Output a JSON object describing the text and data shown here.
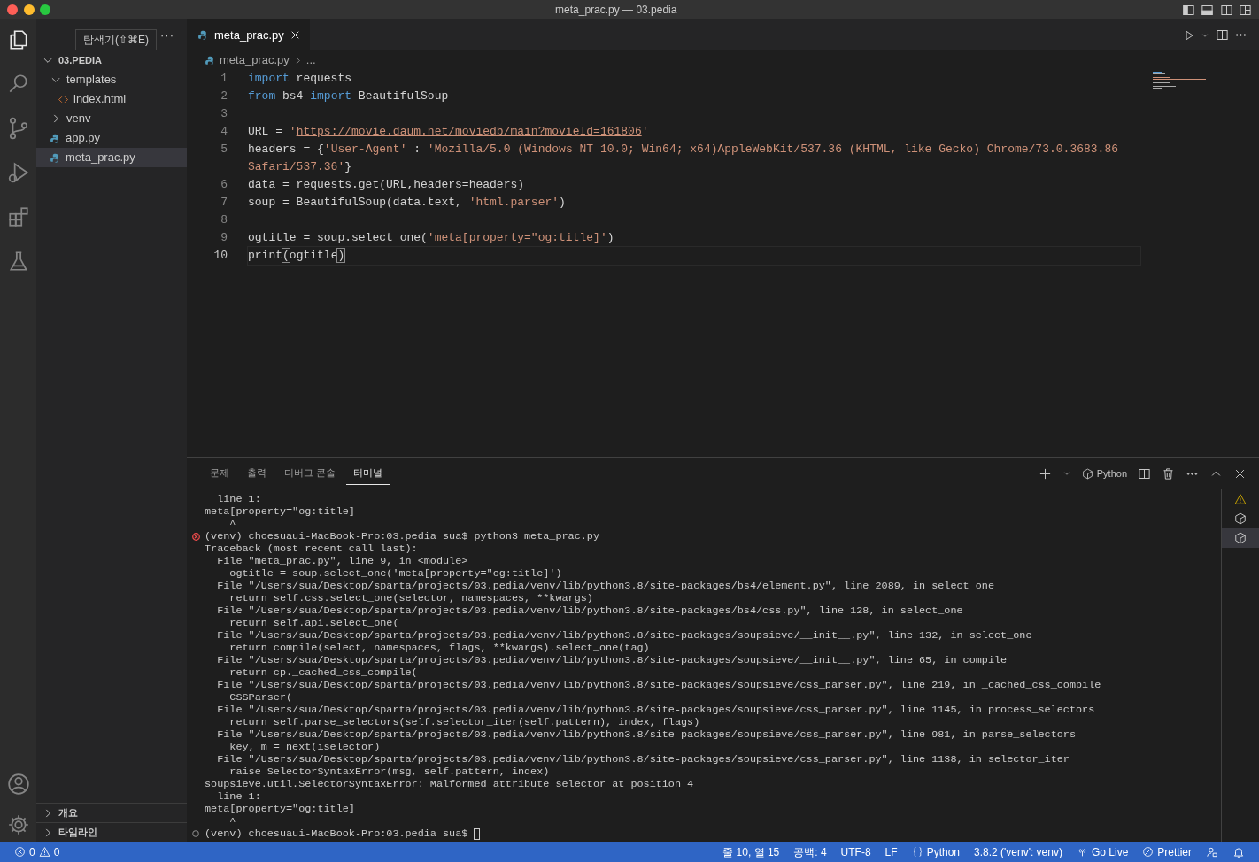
{
  "window": {
    "title": "meta_prac.py — 03.pedia"
  },
  "activity_bar": [
    {
      "kind": "files",
      "selected": true
    },
    {
      "kind": "search",
      "selected": false
    },
    {
      "kind": "source-control",
      "selected": false
    },
    {
      "kind": "run-debug",
      "selected": false
    },
    {
      "kind": "extensions",
      "selected": false
    },
    {
      "kind": "testing",
      "selected": false
    }
  ],
  "activity_bar_bottom": [
    {
      "kind": "account"
    },
    {
      "kind": "settings"
    }
  ],
  "tooltip": "탐색기(⇧⌘E)",
  "explorer": {
    "more": "···",
    "root": {
      "label": "03.PEDIA",
      "expanded": true,
      "children": [
        {
          "label": "templates",
          "expanded": true,
          "selected": false,
          "children": [
            {
              "label": "index.html",
              "kind": "html",
              "selected": false
            }
          ]
        },
        {
          "label": "venv",
          "expanded": false,
          "selected": false
        },
        {
          "label": "app.py",
          "kind": "python",
          "selected": false
        },
        {
          "label": "meta_prac.py",
          "kind": "python",
          "selected": true
        }
      ]
    },
    "sections": [
      {
        "label": "개요",
        "expanded": false
      },
      {
        "label": "타임라인",
        "expanded": false
      }
    ]
  },
  "tabs": [
    {
      "label": "meta_prac.py",
      "kind": "python",
      "selected": true
    }
  ],
  "breadcrumb": {
    "file": "meta_prac.py",
    "rest": "..."
  },
  "code": {
    "lines": [
      {
        "number": "1",
        "current": false,
        "tokens": [
          {
            "kind": "keyword",
            "text": "import"
          },
          {
            "kind": "text",
            "text": " requests"
          }
        ]
      },
      {
        "number": "2",
        "current": false,
        "tokens": [
          {
            "kind": "keyword",
            "text": "from"
          },
          {
            "kind": "text",
            "text": " bs4 "
          },
          {
            "kind": "keyword",
            "text": "import"
          },
          {
            "kind": "text",
            "text": " BeautifulSoup"
          }
        ]
      },
      {
        "number": "3",
        "current": false
      },
      {
        "number": "4",
        "current": false,
        "tokens": [
          {
            "kind": "text",
            "text": "URL = "
          },
          {
            "kind": "string",
            "text": "'"
          },
          {
            "kind": "link",
            "text": "https://movie.daum.net/moviedb/main?movieId=161806"
          },
          {
            "kind": "string",
            "text": "'"
          }
        ]
      },
      {
        "number": "5",
        "current": false,
        "tokens": [
          {
            "kind": "text",
            "text": "headers = {"
          },
          {
            "kind": "string",
            "text": "'User-Agent'"
          },
          {
            "kind": "text",
            "text": " : "
          },
          {
            "kind": "string",
            "text": "'Mozilla/5.0 (Windows NT 10.0; Win64; x64)AppleWebKit/537.36 (KHTML, like Gecko) Chrome/73.0.3683.86 Safari/537.36'"
          },
          {
            "kind": "text",
            "text": "}"
          }
        ]
      },
      {
        "number": "6",
        "current": false,
        "tokens": [
          {
            "kind": "text",
            "text": "data = requests.get(URL,headers=headers)"
          }
        ]
      },
      {
        "number": "7",
        "current": false,
        "tokens": [
          {
            "kind": "text",
            "text": "soup = BeautifulSoup(data.text, "
          },
          {
            "kind": "string",
            "text": "'html.parser'"
          },
          {
            "kind": "text",
            "text": ")"
          }
        ]
      },
      {
        "number": "8",
        "current": false
      },
      {
        "number": "9",
        "current": false,
        "tokens": [
          {
            "kind": "text",
            "text": "ogtitle = soup.select_one("
          },
          {
            "kind": "string",
            "text": "'meta[property=\"og:title]'"
          },
          {
            "kind": "text",
            "text": ")"
          }
        ]
      },
      {
        "number": "10",
        "current": true,
        "tokens": [
          {
            "kind": "text",
            "text": "print"
          },
          {
            "kind": "bracket",
            "text": "("
          },
          {
            "kind": "text",
            "text": "ogtitle"
          },
          {
            "kind": "bracket",
            "text": ")"
          }
        ]
      }
    ]
  },
  "panel": {
    "tabs": [
      {
        "label": "문제",
        "selected": false
      },
      {
        "label": "출력",
        "selected": false
      },
      {
        "label": "디버그 콘솔",
        "selected": false
      },
      {
        "label": "터미널",
        "selected": true
      }
    ],
    "toolbar": [
      {
        "kind": "plus"
      },
      {
        "kind": "caret"
      },
      {
        "kind": "terminal",
        "label": "Python"
      },
      {
        "kind": "split"
      },
      {
        "kind": "trash"
      },
      {
        "kind": "more"
      },
      {
        "kind": "maximize"
      },
      {
        "kind": "close"
      }
    ],
    "terminals": [
      {
        "kind": "warning",
        "selected": false
      },
      {
        "kind": "python",
        "selected": false
      },
      {
        "kind": "python",
        "selected": true
      }
    ],
    "lines": [
      {
        "text": "  line 1:"
      },
      {
        "text": "meta[property=\"og:title]"
      },
      {
        "text": "    ^"
      },
      {
        "text": "(venv) choesuaui-MacBook-Pro:03.pedia sua$ python3 meta_prac.py",
        "failed": true
      },
      {
        "text": "Traceback (most recent call last):"
      },
      {
        "text": "  File \"meta_prac.py\", line 9, in <module>"
      },
      {
        "text": "    ogtitle = soup.select_one('meta[property=\"og:title]')"
      },
      {
        "text": "  File \"/Users/sua/Desktop/sparta/projects/03.pedia/venv/lib/python3.8/site-packages/bs4/element.py\", line 2089, in select_one"
      },
      {
        "text": "    return self.css.select_one(selector, namespaces, **kwargs)"
      },
      {
        "text": "  File \"/Users/sua/Desktop/sparta/projects/03.pedia/venv/lib/python3.8/site-packages/bs4/css.py\", line 128, in select_one"
      },
      {
        "text": "    return self.api.select_one("
      },
      {
        "text": "  File \"/Users/sua/Desktop/sparta/projects/03.pedia/venv/lib/python3.8/site-packages/soupsieve/__init__.py\", line 132, in select_one"
      },
      {
        "text": "    return compile(select, namespaces, flags, **kwargs).select_one(tag)"
      },
      {
        "text": "  File \"/Users/sua/Desktop/sparta/projects/03.pedia/venv/lib/python3.8/site-packages/soupsieve/__init__.py\", line 65, in compile"
      },
      {
        "text": "    return cp._cached_css_compile("
      },
      {
        "text": "  File \"/Users/sua/Desktop/sparta/projects/03.pedia/venv/lib/python3.8/site-packages/soupsieve/css_parser.py\", line 219, in _cached_css_compile"
      },
      {
        "text": "    CSSParser("
      },
      {
        "text": "  File \"/Users/sua/Desktop/sparta/projects/03.pedia/venv/lib/python3.8/site-packages/soupsieve/css_parser.py\", line 1145, in process_selectors"
      },
      {
        "text": "    return self.parse_selectors(self.selector_iter(self.pattern), index, flags)"
      },
      {
        "text": "  File \"/Users/sua/Desktop/sparta/projects/03.pedia/venv/lib/python3.8/site-packages/soupsieve/css_parser.py\", line 981, in parse_selectors"
      },
      {
        "text": "    key, m = next(iselector)"
      },
      {
        "text": "  File \"/Users/sua/Desktop/sparta/projects/03.pedia/venv/lib/python3.8/site-packages/soupsieve/css_parser.py\", line 1138, in selector_iter"
      },
      {
        "text": "    raise SelectorSyntaxError(msg, self.pattern, index)"
      },
      {
        "text": "soupsieve.util.SelectorSyntaxError: Malformed attribute selector at position 4"
      },
      {
        "text": "  line 1:"
      },
      {
        "text": "meta[property=\"og:title]"
      },
      {
        "text": "    ^"
      },
      {
        "text": "(venv) choesuaui-MacBook-Pro:03.pedia sua$ ",
        "failed": false,
        "cursor": true
      }
    ]
  },
  "status_bar": {
    "errors": "0",
    "warnings": "0",
    "items": [
      {
        "text": "줄 10, 열 15"
      },
      {
        "text": "공백: 4"
      },
      {
        "text": "UTF-8"
      },
      {
        "text": "LF"
      },
      {
        "kind": "braces",
        "text": "Python"
      },
      {
        "text": "3.8.2 ('venv': venv)"
      },
      {
        "kind": "broadcast",
        "text": "Go Live"
      },
      {
        "kind": "prohibited",
        "text": "Prettier"
      },
      {
        "kind": "feedback"
      },
      {
        "kind": "bell"
      }
    ]
  }
}
